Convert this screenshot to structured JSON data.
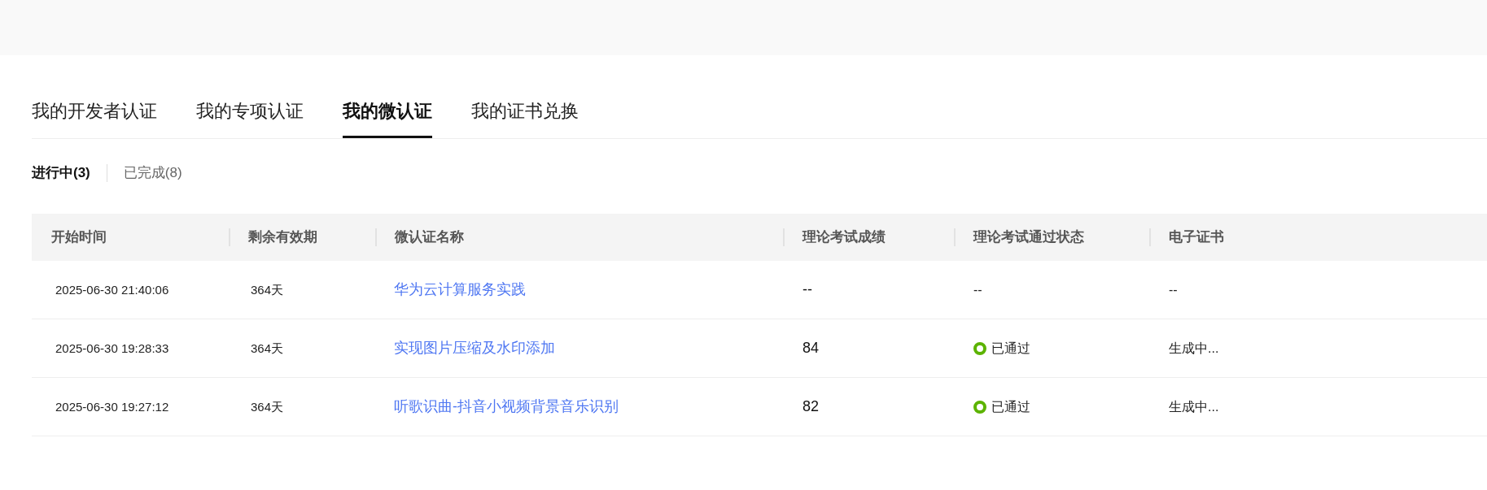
{
  "tabs": [
    {
      "label": "我的开发者认证",
      "selected": false
    },
    {
      "label": "我的专项认证",
      "selected": false
    },
    {
      "label": "我的微认证",
      "selected": true
    },
    {
      "label": "我的证书兑换",
      "selected": false
    }
  ],
  "sub_tabs": [
    {
      "label": "进行中(3)",
      "selected": true
    },
    {
      "label": "已完成(8)",
      "selected": false
    }
  ],
  "table": {
    "columns": [
      "开始时间",
      "剩余有效期",
      "微认证名称",
      "理论考试成绩",
      "理论考试通过状态",
      "电子证书"
    ],
    "rows": [
      {
        "start_time": "2025-06-30 21:40:06",
        "remaining": "364天",
        "name": "华为云计算服务实践",
        "score": "--",
        "status": {
          "kind": "text",
          "text": "--"
        },
        "certificate": "--"
      },
      {
        "start_time": "2025-06-30 19:28:33",
        "remaining": "364天",
        "name": "实现图片压缩及水印添加",
        "score": "84",
        "status": {
          "kind": "passed",
          "text": "已通过"
        },
        "certificate": "生成中..."
      },
      {
        "start_time": "2025-06-30 19:27:12",
        "remaining": "364天",
        "name": "听歌识曲-抖音小视频背景音乐识别",
        "score": "82",
        "status": {
          "kind": "passed",
          "text": "已通过"
        },
        "certificate": "生成中..."
      }
    ]
  }
}
